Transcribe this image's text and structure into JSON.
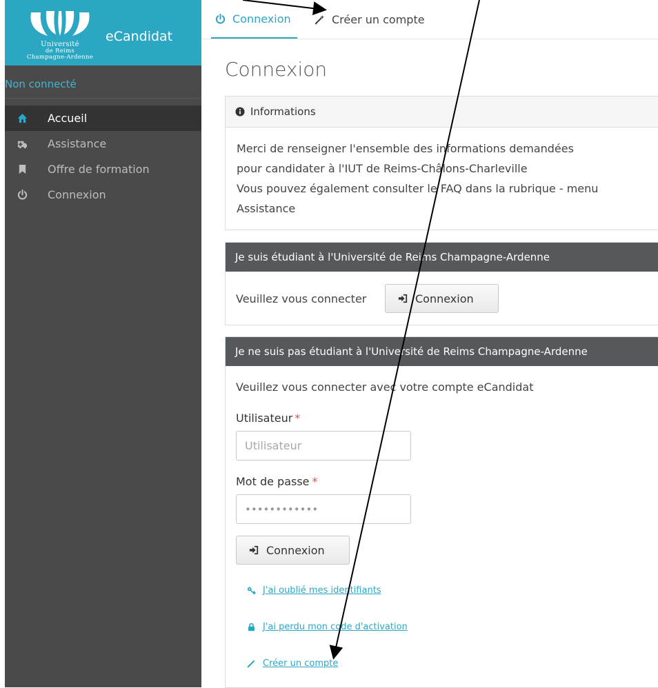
{
  "brand": {
    "university_lines": [
      "Université",
      "de Reims",
      "Champagne-Ardenne"
    ],
    "app_name": "eCandidat",
    "colors": {
      "brand": "#2ba7c4",
      "sidebar": "#4a4a4a",
      "header_dark": "#55595c"
    }
  },
  "sidebar": {
    "status": "Non connecté",
    "items": [
      {
        "label": "Accueil",
        "icon": "home-icon",
        "active": true
      },
      {
        "label": "Assistance",
        "icon": "ambulance-icon",
        "active": false
      },
      {
        "label": "Offre de formation",
        "icon": "bookmark-icon",
        "active": false
      },
      {
        "label": "Connexion",
        "icon": "power-icon",
        "active": false
      }
    ]
  },
  "topbar": {
    "tabs": [
      {
        "label": "Connexion",
        "icon": "power-icon",
        "active": true
      },
      {
        "label": "Créer un compte",
        "icon": "magic-wand-icon",
        "active": false
      }
    ]
  },
  "main": {
    "title": "Connexion",
    "info_panel": {
      "heading": "Informations",
      "lines": [
        "Merci de renseigner l'ensemble des informations demandées",
        "pour candidater à l'IUT de Reims-Châlons-Charleville",
        "Vous pouvez également consulter le FAQ dans la rubrique - menu",
        "Assistance"
      ]
    },
    "student_panel": {
      "heading": "Je suis étudiant à l'Université de Reims Champagne-Ardenne",
      "prompt": "Veuillez vous connecter",
      "button": "Connexion"
    },
    "external_panel": {
      "heading": "Je ne suis pas étudiant à l'Université de Reims Champagne-Ardenne",
      "prompt": "Veuillez vous connecter avec votre compte eCandidat",
      "user_label": "Utilisateur",
      "user_placeholder": "Utilisateur",
      "password_label": "Mot de passe",
      "password_value": "••••••••••••",
      "required_mark": "*",
      "button": "Connexion",
      "links": {
        "forgot": "J'ai oublié mes identifiants",
        "lost_code": "J'ai perdu mon code d'activation",
        "create": "Créer un compte"
      }
    }
  }
}
